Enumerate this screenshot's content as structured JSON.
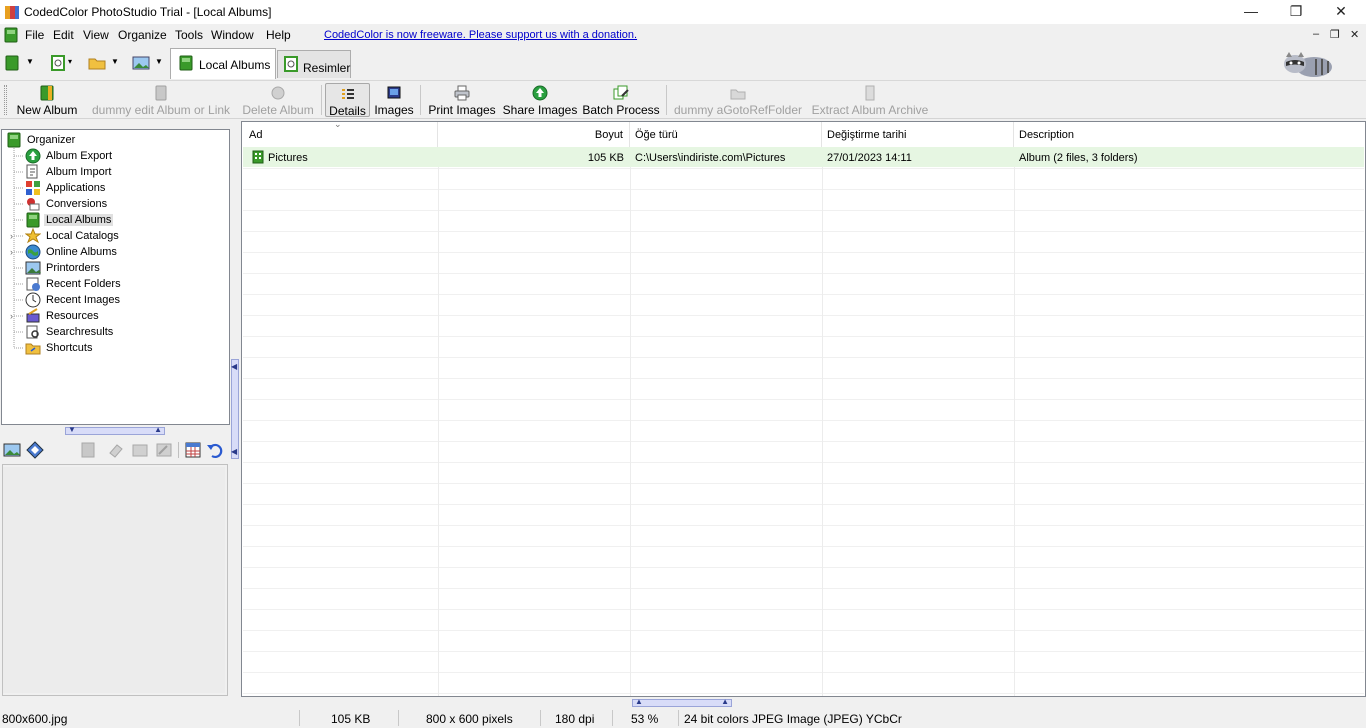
{
  "window": {
    "title": "CodedColor PhotoStudio Trial - [Local Albums]",
    "minimize_glyph": "—",
    "maximize_glyph": "❐",
    "close_glyph": "✕"
  },
  "menu": {
    "items": [
      "File",
      "Edit",
      "View",
      "Organize",
      "Tools",
      "Window",
      "Help"
    ],
    "donation_link": "CodedColor is now freeware. Please support us with a donation."
  },
  "tabs": [
    {
      "label": "Local Albums",
      "icon": "album-book-icon",
      "active": true
    },
    {
      "label": "Resimler",
      "icon": "image-viewer-icon",
      "active": false
    }
  ],
  "toolbar": {
    "buttons": [
      {
        "label": "New Album",
        "enabled": true,
        "icon": "new-album-icon"
      },
      {
        "label": "dummy edit Album or Link",
        "enabled": false,
        "icon": "edit-album-icon"
      },
      {
        "label": "Delete Album",
        "enabled": false,
        "icon": "delete-album-icon"
      },
      {
        "label": "Details",
        "enabled": true,
        "pressed": true,
        "icon": "details-view-icon"
      },
      {
        "label": "Images",
        "enabled": true,
        "icon": "images-view-icon"
      },
      {
        "label": "Print Images",
        "enabled": true,
        "icon": "printer-icon"
      },
      {
        "label": "Share Images",
        "enabled": true,
        "icon": "share-upload-icon"
      },
      {
        "label": "Batch Process",
        "enabled": true,
        "icon": "batch-process-icon"
      },
      {
        "label": "dummy aGotoRefFolder",
        "enabled": false,
        "icon": "goto-folder-icon"
      },
      {
        "label": "Extract Album Archive",
        "enabled": false,
        "icon": "extract-archive-icon"
      }
    ]
  },
  "tree": {
    "root": "Organizer",
    "items": [
      {
        "label": "Album Export",
        "icon": "album-export-icon",
        "expandable": false,
        "selected": false
      },
      {
        "label": "Album Import",
        "icon": "album-import-icon",
        "expandable": false,
        "selected": false
      },
      {
        "label": "Applications",
        "icon": "applications-icon",
        "expandable": false,
        "selected": false
      },
      {
        "label": "Conversions",
        "icon": "conversions-icon",
        "expandable": false,
        "selected": false
      },
      {
        "label": "Local Albums",
        "icon": "local-albums-icon",
        "expandable": false,
        "selected": true
      },
      {
        "label": "Local Catalogs",
        "icon": "star-icon",
        "expandable": true,
        "selected": false
      },
      {
        "label": "Online Albums",
        "icon": "globe-icon",
        "expandable": true,
        "selected": false
      },
      {
        "label": "Printorders",
        "icon": "printorders-icon",
        "expandable": false,
        "selected": false
      },
      {
        "label": "Recent Folders",
        "icon": "recent-folders-icon",
        "expandable": false,
        "selected": false
      },
      {
        "label": "Recent Images",
        "icon": "clock-icon",
        "expandable": false,
        "selected": false
      },
      {
        "label": "Resources",
        "icon": "resources-icon",
        "expandable": true,
        "selected": false
      },
      {
        "label": "Searchresults",
        "icon": "search-results-icon",
        "expandable": false,
        "selected": false
      },
      {
        "label": "Shortcuts",
        "icon": "shortcuts-folder-icon",
        "expandable": false,
        "selected": false
      }
    ]
  },
  "grid": {
    "columns": [
      "Ad",
      "Boyut",
      "Öğe türü",
      "Değiştirme tarihi",
      "Description"
    ],
    "rows": [
      {
        "name": "Pictures",
        "size": "105 KB",
        "type": "C:\\Users\\indiriste.com\\Pictures",
        "modified": "27/01/2023 14:11",
        "description": "Album (2 files, 3 folders)"
      }
    ]
  },
  "statusbar": {
    "filename": "800x600.jpg",
    "filesize": "105 KB",
    "dimensions": "800 x 600 pixels",
    "dpi": "180 dpi",
    "zoom": "53 %",
    "colorinfo": "24 bit colors JPEG Image (JPEG) YCbCr"
  },
  "colors": {
    "selection_row": "#e6f6e2",
    "link": "#0000cc",
    "album_green": "#3a9a2a",
    "splitter": "#d8dcf8"
  }
}
